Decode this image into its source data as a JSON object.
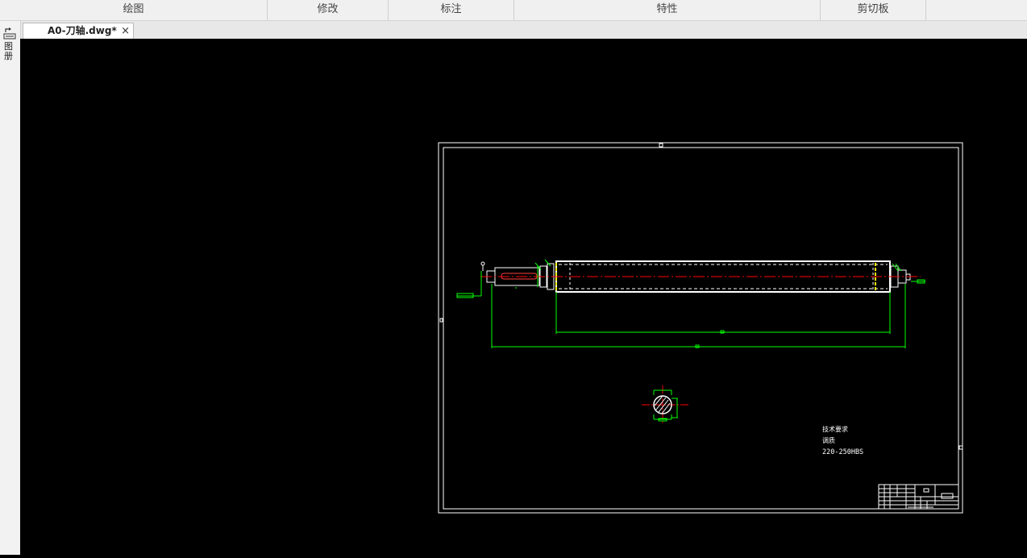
{
  "ribbon": {
    "groups": [
      {
        "label": "绘图"
      },
      {
        "label": "修改"
      },
      {
        "label": "标注"
      },
      {
        "label": "特性"
      },
      {
        "label": "剪切板"
      }
    ]
  },
  "document_tab": {
    "title": "A0-刀轴.dwg*",
    "close_glyph": "×"
  },
  "sidebar": {
    "tool_icon": "properties-palette-icon",
    "label": "图册"
  },
  "drawing": {
    "tech_notes": [
      "技术要求",
      "调质",
      "220-250HBS"
    ],
    "colors": {
      "background": "#000000",
      "border": "#ffffff",
      "dimension": "#00ff00",
      "centerline": "#ff0000",
      "hidden_line": "#ffff00"
    }
  }
}
